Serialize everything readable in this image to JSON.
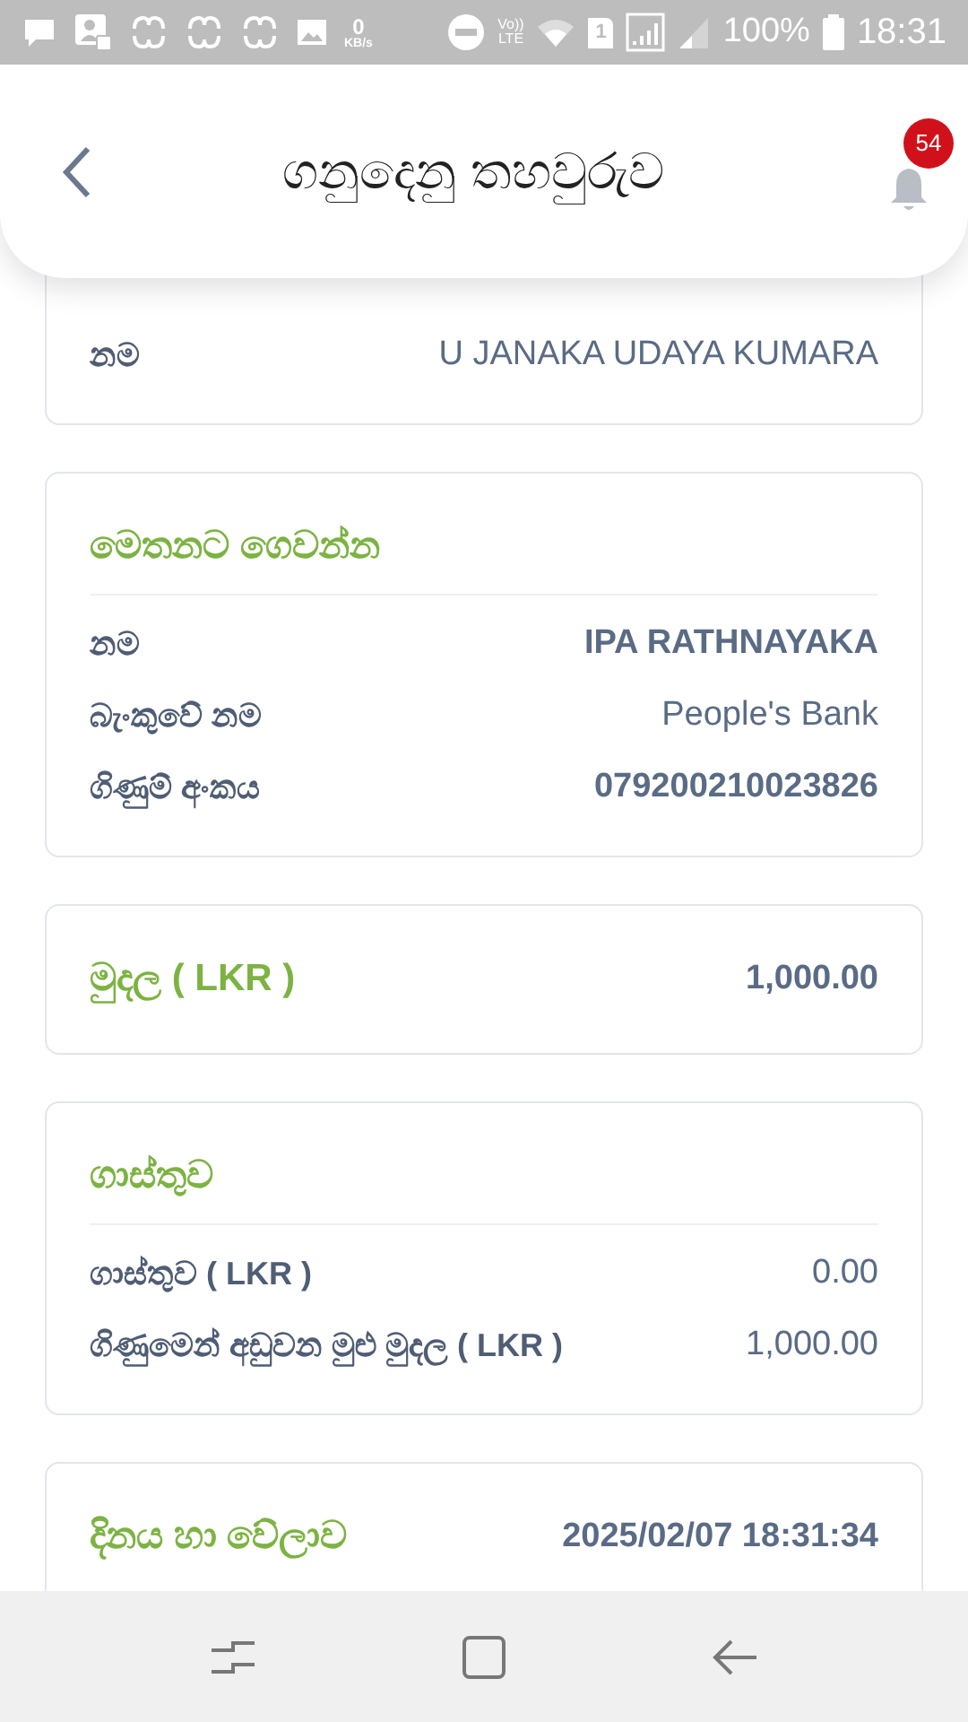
{
  "status_bar": {
    "network_speed": "0",
    "network_speed_unit": "KB/s",
    "volte": "Vo))",
    "lte": "LTE",
    "sim": "1",
    "battery": "100%",
    "time": "18:31"
  },
  "header": {
    "title": "ගනුදෙනු තහවුරුව",
    "notification_count": "54"
  },
  "cards": [
    {
      "rows": [
        {
          "label": "නම",
          "value": "U JANAKA UDAYA KUMARA",
          "emphasis": false
        }
      ]
    },
    {
      "title": "මෙතනට ගෙවන්න",
      "rows": [
        {
          "label": "නම",
          "value": "IPA RATHNAYAKA",
          "emphasis": true
        },
        {
          "label": "බැංකුවේ නම",
          "value": "People's Bank",
          "emphasis": false
        },
        {
          "label": "ගිණුම් අංකය",
          "value": "079200210023826",
          "emphasis": true
        }
      ]
    },
    {
      "title": "මුදල ( LKR )",
      "title_value": "1,000.00"
    },
    {
      "title": "ගාස්තුව",
      "rows": [
        {
          "label": "ගාස්තුව ( LKR )",
          "value": "0.00",
          "emphasis": false
        },
        {
          "label": "ගිණුමෙන් අඩුවන මුළු මුදල ( LKR )",
          "value": "1,000.00",
          "emphasis": false
        }
      ]
    },
    {
      "title": "දිනය හා වේලාව",
      "title_value": "2025/02/07 18:31:34"
    }
  ]
}
